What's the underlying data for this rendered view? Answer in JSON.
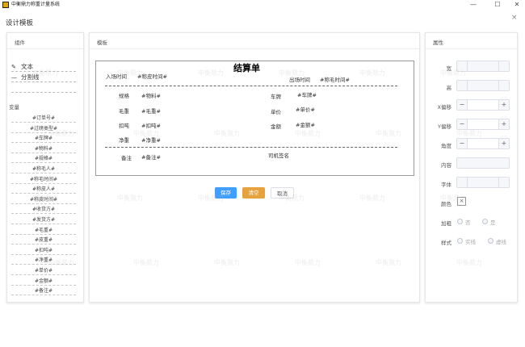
{
  "window": {
    "title": "中衡鼎力称重计量系统",
    "minimize": "—",
    "maximize": "☐",
    "close": "✕"
  },
  "dialog": {
    "title": "设计模板",
    "close": "×"
  },
  "components_panel": {
    "header": "组件",
    "items": [
      {
        "label": "文本",
        "icon": "pencil-icon",
        "glyph": "✎"
      },
      {
        "label": "分割线",
        "icon": "line-icon",
        "glyph": "—"
      }
    ],
    "variables_label": "变量",
    "variables": [
      "#订单号#",
      "#过磅类型#",
      "#车牌#",
      "#物料#",
      "#规格#",
      "#称毛人#",
      "#称毛时间#",
      "#称皮人#",
      "#称皮时间#",
      "#收货方#",
      "#发货方#",
      "#毛重#",
      "#皮重#",
      "#扣吨#",
      "#净重#",
      "#单价#",
      "#金额#",
      "#备注#"
    ]
  },
  "template_panel": {
    "header": "模板",
    "canvas": {
      "title": "结算单",
      "in_time_label": "入场时间",
      "in_time_var": "#称皮时间#",
      "out_time_label": "出场时间",
      "out_time_var": "#称毛时间#",
      "spec_label": "规格",
      "spec_var": "#物料#",
      "plate_label": "车牌",
      "plate_var": "#车牌#",
      "gross_label": "毛重",
      "gross_var": "#毛重#",
      "price_label": "单价",
      "price_var": "#单价#",
      "deduct_label": "扣吨",
      "deduct_var": "#扣吨#",
      "amount_label": "金额",
      "amount_var": "#金额#",
      "net_label": "净重",
      "net_var": "#净重#",
      "remark_label": "备注",
      "remark_var": "#备注#",
      "driver_sign_label": "司机签名"
    },
    "buttons": {
      "save": "保存",
      "reset": "清空",
      "cancel": "取消"
    }
  },
  "properties_panel": {
    "header": "属性",
    "width_label": "宽",
    "height_label": "高",
    "x_offset_label": "X偏移",
    "y_offset_label": "Y偏移",
    "angle_label": "角度",
    "content_label": "内容",
    "font_label": "字体",
    "color_label": "颜色",
    "bold_label": "加粗",
    "bold_options": [
      "否",
      "是"
    ],
    "style_label": "样式",
    "style_options": [
      "实线",
      "虚线"
    ],
    "color_swatch": "×"
  },
  "watermark": "中衡鼎力",
  "colors": {
    "primary": "#409eff",
    "warning": "#e6a23c"
  }
}
